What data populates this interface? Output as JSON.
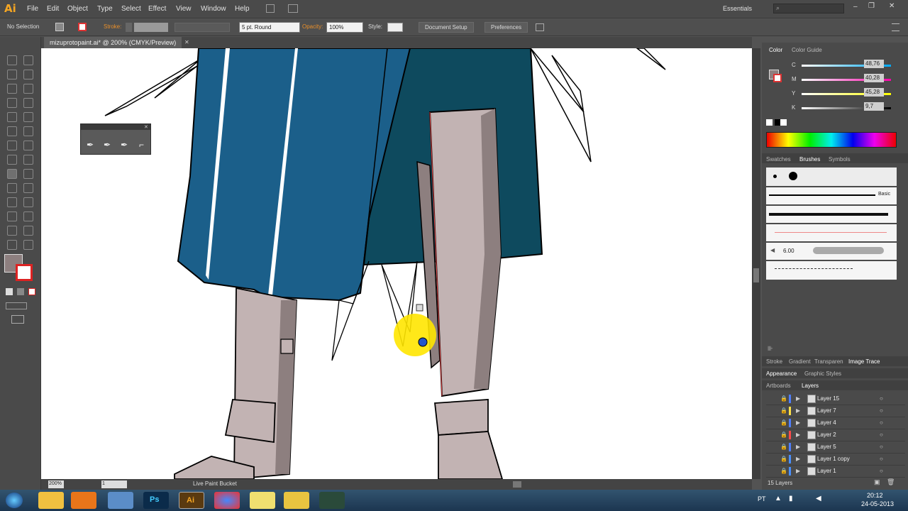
{
  "app": {
    "logo": "Ai",
    "workspace": "Essentials"
  },
  "menus": [
    "File",
    "Edit",
    "Object",
    "Type",
    "Select",
    "Effect",
    "View",
    "Window",
    "Help"
  ],
  "control": {
    "selection": "No Selection",
    "stroke_label": "Stroke:",
    "brush": "5 pt. Round",
    "opacity_label": "Opacity:",
    "opacity": "100%",
    "style_label": "Style:",
    "doc_setup": "Document Setup",
    "preferences": "Preferences"
  },
  "document": {
    "tab": "mizuprotopaint.ai* @ 200% (CMYK/Preview)"
  },
  "status": {
    "zoom": "200%",
    "page": "1",
    "tool": "Live Paint Bucket"
  },
  "color_panel": {
    "tabs": [
      "Color",
      "Color Guide"
    ],
    "channels": [
      {
        "label": "C",
        "value": "48,76"
      },
      {
        "label": "M",
        "value": "40,28"
      },
      {
        "label": "Y",
        "value": "45,28"
      },
      {
        "label": "K",
        "value": "9,7"
      }
    ]
  },
  "brush_panel": {
    "tabs": [
      "Swatches",
      "Brushes",
      "Symbols"
    ],
    "basic": "Basic",
    "size": "6.00"
  },
  "lower_tabs": [
    "Stroke",
    "Gradient",
    "Transparen",
    "Image Trace"
  ],
  "appearance_tabs": [
    "Appearance",
    "Graphic Styles"
  ],
  "layers_tabs": [
    "Artboards",
    "Layers"
  ],
  "layers": [
    {
      "name": "Layer 15",
      "color": "#4f7fff"
    },
    {
      "name": "Layer 7",
      "color": "#ffe14a"
    },
    {
      "name": "Layer 4",
      "color": "#4f7fff"
    },
    {
      "name": "Layer 2",
      "color": "#ff4a4a"
    },
    {
      "name": "Layer 5",
      "color": "#4f7fff"
    },
    {
      "name": "Layer 1 copy",
      "color": "#4a90ff"
    },
    {
      "name": "Layer 1",
      "color": "#4a90ff"
    }
  ],
  "layers_count": "15 Layers",
  "taskbar": {
    "lang": "PT",
    "time": "20:12",
    "date": "24-05-2013"
  },
  "colors": {
    "teal": "#0e4a5e",
    "blue": "#1b5f8a",
    "boot": "#c2b3b3",
    "boot_shadow": "#8d7f7f",
    "highlight": "#ffe600"
  }
}
